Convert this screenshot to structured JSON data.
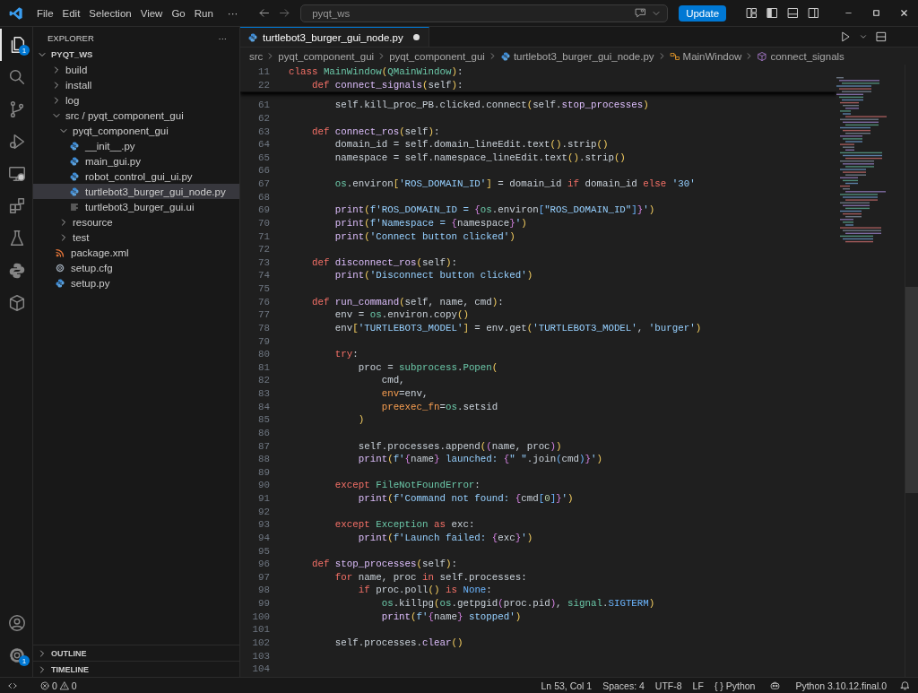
{
  "title_bar": {
    "menu": [
      "File",
      "Edit",
      "Selection",
      "View",
      "Go",
      "Run"
    ],
    "more": "···",
    "search": {
      "value": "pyqt_ws"
    },
    "update_button": "Update"
  },
  "activity_bar": {
    "items": [
      {
        "kind": "explorer",
        "selected": true,
        "badge": "1"
      },
      {
        "kind": "search",
        "selected": false
      },
      {
        "kind": "source-control",
        "selected": false
      },
      {
        "kind": "run-debug",
        "selected": false
      },
      {
        "kind": "remote",
        "selected": false
      },
      {
        "kind": "extensions",
        "selected": false
      },
      {
        "kind": "testing",
        "selected": false
      },
      {
        "kind": "python",
        "selected": false
      },
      {
        "kind": "package",
        "selected": false
      }
    ],
    "bottom": [
      {
        "kind": "account"
      },
      {
        "kind": "settings",
        "badge": "1"
      }
    ]
  },
  "sidebar": {
    "title": "EXPLORER",
    "more": "···",
    "root": {
      "label": "PYQT_WS",
      "expanded": true
    },
    "tree": [
      {
        "label": "build",
        "kind": "folder",
        "expanded": false,
        "selected": false
      },
      {
        "label": "install",
        "kind": "folder",
        "expanded": false,
        "selected": false
      },
      {
        "label": "log",
        "kind": "folder",
        "expanded": false,
        "selected": false
      },
      {
        "label": "src / pyqt_component_gui",
        "kind": "folder",
        "expanded": true,
        "selected": false,
        "children": [
          {
            "label": "pyqt_component_gui",
            "kind": "folder",
            "expanded": true,
            "selected": false,
            "children": [
              {
                "label": "__init__.py",
                "kind": "python",
                "selected": false
              },
              {
                "label": "main_gui.py",
                "kind": "python",
                "selected": false
              },
              {
                "label": "robot_control_gui_ui.py",
                "kind": "python",
                "selected": false
              },
              {
                "label": "turtlebot3_burger_gui_node.py",
                "kind": "python",
                "selected": true
              },
              {
                "label": "turtlebot3_burger_gui.ui",
                "kind": "ui",
                "selected": false
              }
            ]
          },
          {
            "label": "resource",
            "kind": "folder",
            "expanded": false,
            "selected": false
          },
          {
            "label": "test",
            "kind": "folder",
            "expanded": false,
            "selected": false
          }
        ]
      },
      {
        "label": "package.xml",
        "kind": "xml",
        "selected": false
      },
      {
        "label": "setup.cfg",
        "kind": "config",
        "selected": false
      },
      {
        "label": "setup.py",
        "kind": "python",
        "selected": false
      }
    ],
    "sections": [
      {
        "label": "OUTLINE",
        "expanded": false
      },
      {
        "label": "TIMELINE",
        "expanded": false
      }
    ]
  },
  "editor": {
    "tabs": [
      {
        "label": "turtlebot3_burger_gui_node.py",
        "selected": true,
        "modified": true
      }
    ],
    "breadcrumb": [
      {
        "label": "src",
        "kind": "folder"
      },
      {
        "label": "pyqt_component_gui",
        "kind": "folder"
      },
      {
        "label": "pyqt_component_gui",
        "kind": "folder"
      },
      {
        "label": "turtlebot3_burger_gui_node.py",
        "kind": "python"
      },
      {
        "label": "MainWindow",
        "kind": "class"
      },
      {
        "label": "connect_signals",
        "kind": "method"
      }
    ],
    "sticky_lines": [
      {
        "number": "11",
        "tokens": [
          {
            "kind": "k",
            "text": "class"
          },
          {
            "kind": "c",
            "text": " MainWindow"
          },
          {
            "kind": "b",
            "text": "("
          },
          {
            "kind": "c",
            "text": "QMainWindow"
          },
          {
            "kind": "b",
            "text": ")"
          },
          {
            "kind": "p",
            "text": ":"
          }
        ]
      },
      {
        "number": "22",
        "tokens": [
          {
            "kind": "k",
            "text": "    def"
          },
          {
            "kind": "f",
            "text": " connect_signals"
          },
          {
            "kind": "b",
            "text": "("
          },
          {
            "kind": "p",
            "text": "self"
          },
          {
            "kind": "b",
            "text": ")"
          },
          {
            "kind": "p",
            "text": ":"
          }
        ]
      }
    ],
    "lines": [
      {
        "number": "61",
        "tokens": [
          {
            "kind": "p",
            "text": "        self.kill_proc_PB.clicked.connect"
          },
          {
            "kind": "b",
            "text": "("
          },
          {
            "kind": "p",
            "text": "self."
          },
          {
            "kind": "f",
            "text": "stop_processes"
          },
          {
            "kind": "b",
            "text": ")"
          }
        ]
      },
      {
        "number": "62"
      },
      {
        "number": "63",
        "tokens": [
          {
            "kind": "k",
            "text": "    def"
          },
          {
            "kind": "f",
            "text": " connect_ros"
          },
          {
            "kind": "b",
            "text": "("
          },
          {
            "kind": "p",
            "text": "self"
          },
          {
            "kind": "b",
            "text": ")"
          },
          {
            "kind": "p",
            "text": ":"
          }
        ]
      },
      {
        "number": "64",
        "tokens": [
          {
            "kind": "p",
            "text": "        domain_id = self.domain_lineEdit.text"
          },
          {
            "kind": "b",
            "text": "()"
          },
          {
            "kind": "p",
            "text": ".strip"
          },
          {
            "kind": "b",
            "text": "()"
          }
        ]
      },
      {
        "number": "65",
        "tokens": [
          {
            "kind": "p",
            "text": "        namespace = self.namespace_lineEdit.text"
          },
          {
            "kind": "b",
            "text": "()"
          },
          {
            "kind": "p",
            "text": ".strip"
          },
          {
            "kind": "b",
            "text": "()"
          }
        ]
      },
      {
        "number": "66"
      },
      {
        "number": "67",
        "tokens": [
          {
            "kind": "c",
            "text": "        os"
          },
          {
            "kind": "p",
            "text": ".environ"
          },
          {
            "kind": "b",
            "text": "["
          },
          {
            "kind": "s",
            "text": "'ROS_DOMAIN_ID'"
          },
          {
            "kind": "b",
            "text": "]"
          },
          {
            "kind": "p",
            "text": " = domain_id "
          },
          {
            "kind": "k",
            "text": "if"
          },
          {
            "kind": "p",
            "text": " domain_id "
          },
          {
            "kind": "k",
            "text": "else"
          },
          {
            "kind": "s",
            "text": " '30'"
          }
        ]
      },
      {
        "number": "68"
      },
      {
        "number": "69",
        "tokens": [
          {
            "kind": "f",
            "text": "        print"
          },
          {
            "kind": "b",
            "text": "("
          },
          {
            "kind": "s",
            "text": "f'ROS_DOMAIN_ID = "
          },
          {
            "kind": "m",
            "text": "{"
          },
          {
            "kind": "c",
            "text": "os"
          },
          {
            "kind": "p",
            "text": ".environ"
          },
          {
            "kind": "n",
            "text": "["
          },
          {
            "kind": "s",
            "text": "\"ROS_DOMAIN_ID\""
          },
          {
            "kind": "n",
            "text": "]"
          },
          {
            "kind": "m",
            "text": "}"
          },
          {
            "kind": "s",
            "text": "'"
          },
          {
            "kind": "b",
            "text": ")"
          }
        ]
      },
      {
        "number": "70",
        "tokens": [
          {
            "kind": "f",
            "text": "        print"
          },
          {
            "kind": "b",
            "text": "("
          },
          {
            "kind": "s",
            "text": "f'Namespace = "
          },
          {
            "kind": "m",
            "text": "{"
          },
          {
            "kind": "p",
            "text": "namespace"
          },
          {
            "kind": "m",
            "text": "}"
          },
          {
            "kind": "s",
            "text": "'"
          },
          {
            "kind": "b",
            "text": ")"
          }
        ]
      },
      {
        "number": "71",
        "tokens": [
          {
            "kind": "f",
            "text": "        print"
          },
          {
            "kind": "b",
            "text": "("
          },
          {
            "kind": "s",
            "text": "'Connect button clicked'"
          },
          {
            "kind": "b",
            "text": ")"
          }
        ]
      },
      {
        "number": "72"
      },
      {
        "number": "73",
        "tokens": [
          {
            "kind": "k",
            "text": "    def"
          },
          {
            "kind": "f",
            "text": " disconnect_ros"
          },
          {
            "kind": "b",
            "text": "("
          },
          {
            "kind": "p",
            "text": "self"
          },
          {
            "kind": "b",
            "text": ")"
          },
          {
            "kind": "p",
            "text": ":"
          }
        ]
      },
      {
        "number": "74",
        "tokens": [
          {
            "kind": "f",
            "text": "        print"
          },
          {
            "kind": "b",
            "text": "("
          },
          {
            "kind": "s",
            "text": "'Disconnect button clicked'"
          },
          {
            "kind": "b",
            "text": ")"
          }
        ]
      },
      {
        "number": "75"
      },
      {
        "number": "76",
        "tokens": [
          {
            "kind": "k",
            "text": "    def"
          },
          {
            "kind": "f",
            "text": " run_command"
          },
          {
            "kind": "b",
            "text": "("
          },
          {
            "kind": "p",
            "text": "self, name, cmd"
          },
          {
            "kind": "b",
            "text": ")"
          },
          {
            "kind": "p",
            "text": ":"
          }
        ]
      },
      {
        "number": "77",
        "tokens": [
          {
            "kind": "p",
            "text": "        env ="
          },
          {
            "kind": "c",
            "text": " os"
          },
          {
            "kind": "p",
            "text": ".environ.copy"
          },
          {
            "kind": "b",
            "text": "()"
          }
        ]
      },
      {
        "number": "78",
        "tokens": [
          {
            "kind": "p",
            "text": "        env"
          },
          {
            "kind": "b",
            "text": "["
          },
          {
            "kind": "s",
            "text": "'TURTLEBOT3_MODEL'"
          },
          {
            "kind": "b",
            "text": "]"
          },
          {
            "kind": "p",
            "text": " = env.get"
          },
          {
            "kind": "b",
            "text": "("
          },
          {
            "kind": "s",
            "text": "'TURTLEBOT3_MODEL'"
          },
          {
            "kind": "p",
            "text": ","
          },
          {
            "kind": "s",
            "text": " 'burger'"
          },
          {
            "kind": "b",
            "text": ")"
          }
        ]
      },
      {
        "number": "79"
      },
      {
        "number": "80",
        "tokens": [
          {
            "kind": "k",
            "text": "        try"
          },
          {
            "kind": "p",
            "text": ":"
          }
        ]
      },
      {
        "number": "81",
        "tokens": [
          {
            "kind": "p",
            "text": "            proc ="
          },
          {
            "kind": "c",
            "text": " subprocess"
          },
          {
            "kind": "p",
            "text": "."
          },
          {
            "kind": "c",
            "text": "Popen"
          },
          {
            "kind": "b",
            "text": "("
          }
        ]
      },
      {
        "number": "82",
        "tokens": [
          {
            "kind": "p",
            "text": "                cmd,"
          }
        ]
      },
      {
        "number": "83",
        "tokens": [
          {
            "kind": "a",
            "text": "                env"
          },
          {
            "kind": "p",
            "text": "=env,"
          }
        ]
      },
      {
        "number": "84",
        "tokens": [
          {
            "kind": "a",
            "text": "                preexec_fn"
          },
          {
            "kind": "p",
            "text": "="
          },
          {
            "kind": "c",
            "text": "os"
          },
          {
            "kind": "p",
            "text": ".setsid"
          }
        ]
      },
      {
        "number": "85",
        "tokens": [
          {
            "kind": "b",
            "text": "            )"
          }
        ]
      },
      {
        "number": "86"
      },
      {
        "number": "87",
        "tokens": [
          {
            "kind": "p",
            "text": "            self.processes.append"
          },
          {
            "kind": "b",
            "text": "("
          },
          {
            "kind": "m",
            "text": "("
          },
          {
            "kind": "p",
            "text": "name, proc"
          },
          {
            "kind": "m",
            "text": ")"
          },
          {
            "kind": "b",
            "text": ")"
          }
        ]
      },
      {
        "number": "88",
        "tokens": [
          {
            "kind": "f",
            "text": "            print"
          },
          {
            "kind": "b",
            "text": "("
          },
          {
            "kind": "s",
            "text": "f'"
          },
          {
            "kind": "m",
            "text": "{"
          },
          {
            "kind": "p",
            "text": "name"
          },
          {
            "kind": "m",
            "text": "}"
          },
          {
            "kind": "s",
            "text": " launched: "
          },
          {
            "kind": "m",
            "text": "{"
          },
          {
            "kind": "s",
            "text": "\" \""
          },
          {
            "kind": "p",
            "text": ".join"
          },
          {
            "kind": "n",
            "text": "("
          },
          {
            "kind": "p",
            "text": "cmd"
          },
          {
            "kind": "n",
            "text": ")"
          },
          {
            "kind": "m",
            "text": "}"
          },
          {
            "kind": "s",
            "text": "'"
          },
          {
            "kind": "b",
            "text": ")"
          }
        ]
      },
      {
        "number": "89"
      },
      {
        "number": "90",
        "tokens": [
          {
            "kind": "k",
            "text": "        except"
          },
          {
            "kind": "c",
            "text": " FileNotFoundError"
          },
          {
            "kind": "p",
            "text": ":"
          }
        ]
      },
      {
        "number": "91",
        "tokens": [
          {
            "kind": "f",
            "text": "            print"
          },
          {
            "kind": "b",
            "text": "("
          },
          {
            "kind": "s",
            "text": "f'Command not found: "
          },
          {
            "kind": "m",
            "text": "{"
          },
          {
            "kind": "p",
            "text": "cmd"
          },
          {
            "kind": "n",
            "text": "["
          },
          {
            "kind": "g",
            "text": "0"
          },
          {
            "kind": "n",
            "text": "]"
          },
          {
            "kind": "m",
            "text": "}"
          },
          {
            "kind": "s",
            "text": "'"
          },
          {
            "kind": "b",
            "text": ")"
          }
        ]
      },
      {
        "number": "92"
      },
      {
        "number": "93",
        "tokens": [
          {
            "kind": "k",
            "text": "        except"
          },
          {
            "kind": "c",
            "text": " Exception"
          },
          {
            "kind": "k",
            "text": " as"
          },
          {
            "kind": "p",
            "text": " exc:"
          }
        ]
      },
      {
        "number": "94",
        "tokens": [
          {
            "kind": "f",
            "text": "            print"
          },
          {
            "kind": "b",
            "text": "("
          },
          {
            "kind": "s",
            "text": "f'Launch failed: "
          },
          {
            "kind": "m",
            "text": "{"
          },
          {
            "kind": "p",
            "text": "exc"
          },
          {
            "kind": "m",
            "text": "}"
          },
          {
            "kind": "s",
            "text": "'"
          },
          {
            "kind": "b",
            "text": ")"
          }
        ]
      },
      {
        "number": "95"
      },
      {
        "number": "96",
        "tokens": [
          {
            "kind": "k",
            "text": "    def"
          },
          {
            "kind": "f",
            "text": " stop_processes"
          },
          {
            "kind": "b",
            "text": "("
          },
          {
            "kind": "p",
            "text": "self"
          },
          {
            "kind": "b",
            "text": ")"
          },
          {
            "kind": "p",
            "text": ":"
          }
        ]
      },
      {
        "number": "97",
        "tokens": [
          {
            "kind": "k",
            "text": "        for"
          },
          {
            "kind": "p",
            "text": " name, proc "
          },
          {
            "kind": "k",
            "text": "in"
          },
          {
            "kind": "p",
            "text": " self.processes:"
          }
        ]
      },
      {
        "number": "98",
        "tokens": [
          {
            "kind": "k",
            "text": "            if"
          },
          {
            "kind": "p",
            "text": " proc.poll"
          },
          {
            "kind": "b",
            "text": "()"
          },
          {
            "kind": "k",
            "text": " is"
          },
          {
            "kind": "n",
            "text": " None"
          },
          {
            "kind": "p",
            "text": ":"
          }
        ]
      },
      {
        "number": "99",
        "tokens": [
          {
            "kind": "c",
            "text": "                os"
          },
          {
            "kind": "p",
            "text": ".killpg"
          },
          {
            "kind": "b",
            "text": "("
          },
          {
            "kind": "c",
            "text": "os"
          },
          {
            "kind": "p",
            "text": ".getpgid"
          },
          {
            "kind": "m",
            "text": "("
          },
          {
            "kind": "p",
            "text": "proc.pid"
          },
          {
            "kind": "m",
            "text": ")"
          },
          {
            "kind": "p",
            "text": ","
          },
          {
            "kind": "c",
            "text": " signal"
          },
          {
            "kind": "p",
            "text": "."
          },
          {
            "kind": "n",
            "text": "SIGTERM"
          },
          {
            "kind": "b",
            "text": ")"
          }
        ]
      },
      {
        "number": "100",
        "tokens": [
          {
            "kind": "f",
            "text": "                print"
          },
          {
            "kind": "b",
            "text": "("
          },
          {
            "kind": "s",
            "text": "f'"
          },
          {
            "kind": "m",
            "text": "{"
          },
          {
            "kind": "p",
            "text": "name"
          },
          {
            "kind": "m",
            "text": "}"
          },
          {
            "kind": "s",
            "text": " stopped'"
          },
          {
            "kind": "b",
            "text": ")"
          }
        ]
      },
      {
        "number": "101"
      },
      {
        "number": "102",
        "tokens": [
          {
            "kind": "p",
            "text": "        self.processes."
          },
          {
            "kind": "f",
            "text": "clear"
          },
          {
            "kind": "b",
            "text": "()"
          }
        ]
      },
      {
        "number": "103"
      },
      {
        "number": "104"
      }
    ]
  },
  "status_bar": {
    "errors": "0",
    "warnings": "0",
    "items": [
      "Ln 53, Col 1",
      "Spaces: 4",
      "UTF-8",
      "LF",
      "{ } Python"
    ],
    "interpreter": "Python 3.10.12.final.0"
  }
}
